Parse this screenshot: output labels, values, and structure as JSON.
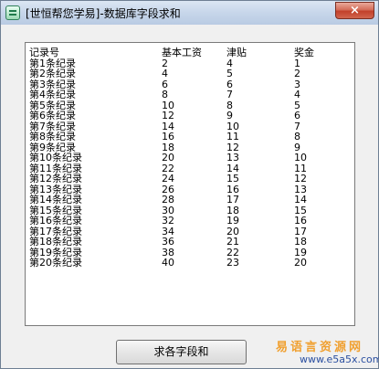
{
  "window": {
    "title": "[世恒帮您学易]-数据库字段求和",
    "close_label": "×"
  },
  "table": {
    "headers": [
      "记录号",
      "基本工资",
      "津贴",
      "奖金"
    ],
    "rows": [
      [
        "第1条纪录",
        "2",
        "4",
        "1"
      ],
      [
        "第2条纪录",
        "4",
        "5",
        "2"
      ],
      [
        "第3条纪录",
        "6",
        "6",
        "3"
      ],
      [
        "第4条纪录",
        "8",
        "7",
        "4"
      ],
      [
        "第5条纪录",
        "10",
        "8",
        "5"
      ],
      [
        "第6条纪录",
        "12",
        "9",
        "6"
      ],
      [
        "第7条纪录",
        "14",
        "10",
        "7"
      ],
      [
        "第8条纪录",
        "16",
        "11",
        "8"
      ],
      [
        "第9条纪录",
        "18",
        "12",
        "9"
      ],
      [
        "第10条纪录",
        "20",
        "13",
        "10"
      ],
      [
        "第11条纪录",
        "22",
        "14",
        "11"
      ],
      [
        "第12条纪录",
        "24",
        "15",
        "12"
      ],
      [
        "第13条纪录",
        "26",
        "16",
        "13"
      ],
      [
        "第14条纪录",
        "28",
        "17",
        "14"
      ],
      [
        "第15条纪录",
        "30",
        "18",
        "15"
      ],
      [
        "第16条纪录",
        "32",
        "19",
        "16"
      ],
      [
        "第17条纪录",
        "34",
        "20",
        "17"
      ],
      [
        "第18条纪录",
        "36",
        "21",
        "18"
      ],
      [
        "第19条纪录",
        "38",
        "22",
        "19"
      ],
      [
        "第20条纪录",
        "40",
        "23",
        "20"
      ]
    ]
  },
  "button": {
    "sum_label": "求各字段和"
  },
  "watermark": {
    "top": "易语言资源网",
    "bottom": "www.e5a5x.com"
  }
}
